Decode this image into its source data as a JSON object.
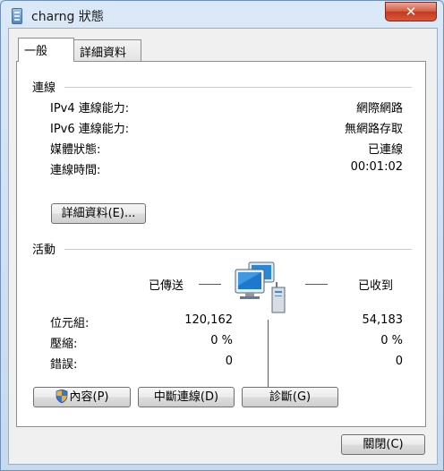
{
  "window": {
    "title": "charng 狀態",
    "close_label": "✕"
  },
  "tabs": [
    {
      "label": "一般"
    },
    {
      "label": "詳細資料"
    }
  ],
  "connection": {
    "heading": "連線",
    "rows": [
      {
        "label": "IPv4 連線能力:",
        "value": "網際網路"
      },
      {
        "label": "IPv6 連線能力:",
        "value": "無網路存取"
      },
      {
        "label": "媒體狀態:",
        "value": "已連線"
      },
      {
        "label": "連線時間:",
        "value": "00:01:02"
      }
    ],
    "details_button": "詳細資料(E)..."
  },
  "activity": {
    "heading": "活動",
    "sent_label": "已傳送",
    "received_label": "已收到",
    "rows": [
      {
        "label": "位元組:",
        "sent": "120,162",
        "received": "54,183"
      },
      {
        "label": "壓縮:",
        "sent": "0 %",
        "received": "0 %"
      },
      {
        "label": "錯誤:",
        "sent": "0",
        "received": "0"
      }
    ]
  },
  "buttons": {
    "properties": "內容(P)",
    "disable": "中斷連線(D)",
    "diagnose": "診斷(G)",
    "close": "關閉(C)"
  }
}
